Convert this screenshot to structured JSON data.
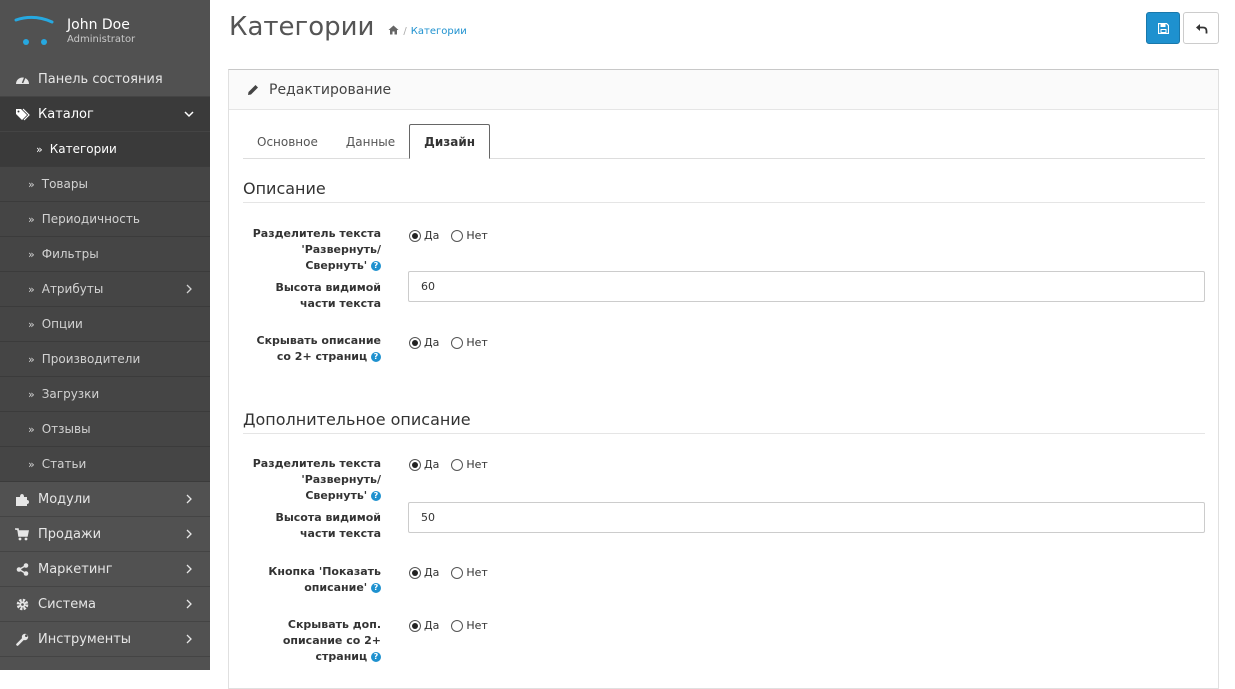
{
  "profile": {
    "name": "John Doe",
    "role": "Administrator"
  },
  "menu": [
    {
      "label": "Панель состояния",
      "icon": "dashboard-icon"
    },
    {
      "label": "Каталог",
      "icon": "tags-icon",
      "expanded": true
    },
    {
      "label": "Модули",
      "icon": "puzzle-icon"
    },
    {
      "label": "Продажи",
      "icon": "shopping-cart-icon"
    },
    {
      "label": "Маркетинг",
      "icon": "share-icon"
    },
    {
      "label": "Система",
      "icon": "cog-icon"
    },
    {
      "label": "Инструменты",
      "icon": "wrench-icon"
    }
  ],
  "catalog_sub": [
    {
      "label": "Категории"
    },
    {
      "label": "Товары"
    },
    {
      "label": "Периодичность"
    },
    {
      "label": "Фильтры"
    },
    {
      "label": "Атрибуты"
    },
    {
      "label": "Опции"
    },
    {
      "label": "Производители"
    },
    {
      "label": "Загрузки"
    },
    {
      "label": "Отзывы"
    },
    {
      "label": "Статьи"
    }
  ],
  "header": {
    "title": "Категории",
    "breadcrumb": "Категории"
  },
  "panel": {
    "title": "Редактирование"
  },
  "tabs": [
    "Основное",
    "Данные",
    "Дизайн"
  ],
  "section1": {
    "title": "Описание",
    "toggle_label": "Разделитель текста 'Развернуть/Свернуть'",
    "height_label": "Высота видимой части текста",
    "height_value": "60",
    "hide_label": "Скрывать описание со 2+ страниц"
  },
  "section2": {
    "title": "Дополнительное описание",
    "toggle_label": "Разделитель текста 'Развернуть/Свернуть'",
    "height_label": "Высота видимой части текста",
    "height_value": "50",
    "button_label": "Кнопка 'Показать описание'",
    "hide_label": "Скрывать доп. описание со 2+ страниц"
  },
  "radio": {
    "yes": "Да",
    "no": "Нет"
  },
  "help_glyph": "?",
  "colors": {
    "sidebar": "#515151",
    "accent": "#1e91cf",
    "logo": "#26a8e0"
  }
}
